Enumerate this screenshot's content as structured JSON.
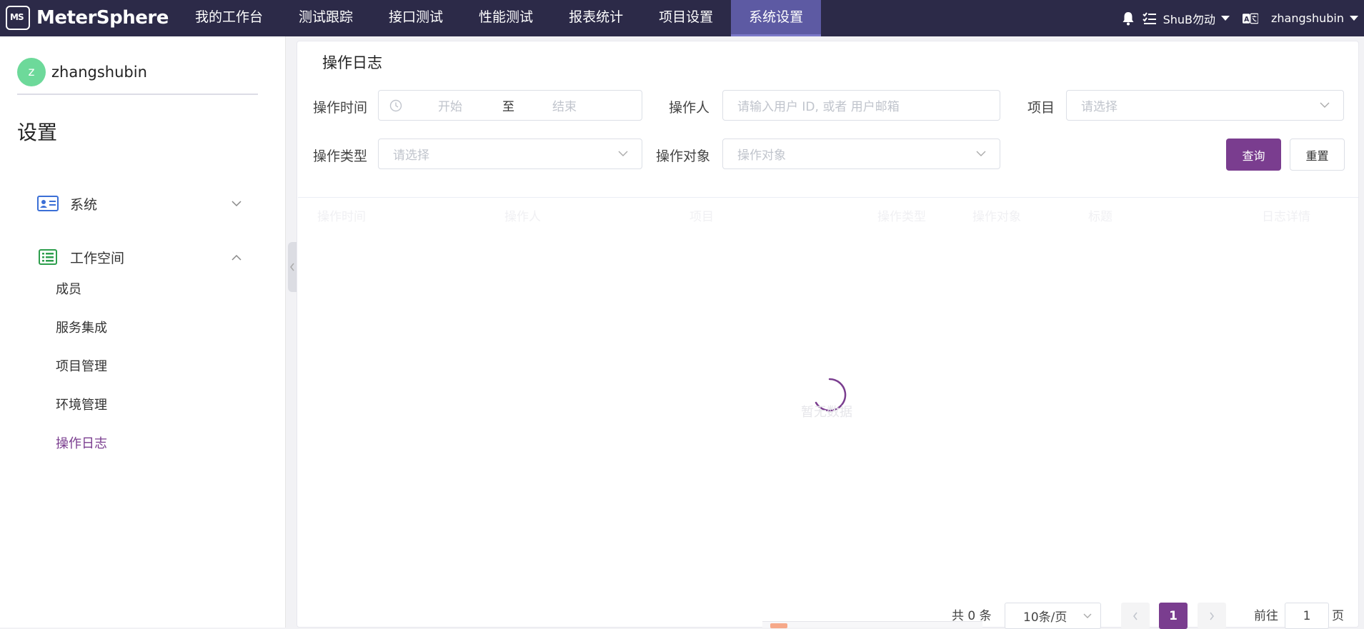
{
  "header": {
    "logo": "MeterSphere",
    "nav": [
      {
        "label": "我的工作台"
      },
      {
        "label": "测试跟踪"
      },
      {
        "label": "接口测试"
      },
      {
        "label": "性能测试"
      },
      {
        "label": "报表统计"
      },
      {
        "label": "项目设置"
      },
      {
        "label": "系统设置"
      }
    ],
    "workspace": "ShuB勿动",
    "user": "zhangshubin"
  },
  "sidebar": {
    "avatar_letter": "z",
    "username": "zhangshubin",
    "title": "设置",
    "groups": [
      {
        "label": "系统",
        "icon": "id-card-icon",
        "expanded": false
      },
      {
        "label": "工作空间",
        "icon": "list-icon",
        "expanded": true
      }
    ],
    "items": [
      {
        "label": "成员"
      },
      {
        "label": "服务集成"
      },
      {
        "label": "项目管理"
      },
      {
        "label": "环境管理"
      },
      {
        "label": "操作日志",
        "active": true
      }
    ]
  },
  "main": {
    "title": "操作日志",
    "filters": {
      "time_label": "操作时间",
      "time_start": "开始",
      "time_sep": "至",
      "time_end": "结束",
      "operator_label": "操作人",
      "operator_placeholder": "请输入用户 ID, 或者 用户邮箱",
      "project_label": "项目",
      "project_placeholder": "请选择",
      "type_label": "操作类型",
      "type_placeholder": "请选择",
      "object_label": "操作对象",
      "object_placeholder": "操作对象",
      "query_button": "查询",
      "reset_button": "重置"
    },
    "table": {
      "columns": [
        "操作时间",
        "操作人",
        "项目",
        "操作类型",
        "操作对象",
        "标题",
        "日志详情"
      ],
      "empty_text": "暂无数据"
    },
    "pagination": {
      "total": "共 0 条",
      "page_size": "10条/页",
      "current_page": "1",
      "goto_label": "前往",
      "goto_value": "1",
      "page_suffix": "页"
    }
  },
  "colors": {
    "topbar": "#2c2a48",
    "accent": "#7a3d8f",
    "active_nav": "#5d5aa3"
  }
}
